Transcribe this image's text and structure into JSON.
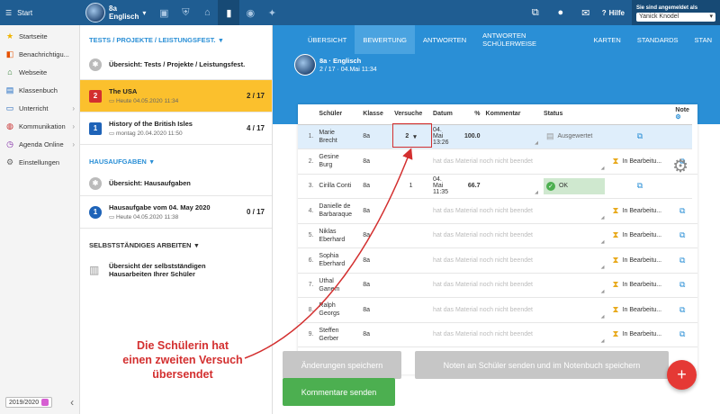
{
  "topbar": {
    "start_label": "Start",
    "class_name": "8a",
    "class_subject": "Englisch",
    "help_label": "Hilfe",
    "logged_in_label": "Sie sind angemeldet als",
    "user_name": "Yanick Knodel",
    "icons": [
      "briefcase-icon",
      "shield-icon",
      "school-icon",
      "chart-icon",
      "globe-icon",
      "walking-icon",
      "screen-share-icon",
      "chat-icon",
      "mail-icon",
      "help-icon"
    ]
  },
  "sidebar": {
    "items": [
      {
        "label": "Startseite",
        "icon": "star-icon"
      },
      {
        "label": "Benachrichtigu...",
        "icon": "bell-icon"
      },
      {
        "label": "Webseite",
        "icon": "house-icon"
      },
      {
        "label": "Klassenbuch",
        "icon": "book-icon"
      },
      {
        "label": "Unterricht",
        "icon": "folder-icon"
      },
      {
        "label": "Kommunikation",
        "icon": "chat-icon"
      },
      {
        "label": "Agenda Online",
        "icon": "clock-icon"
      },
      {
        "label": "Einstellungen",
        "icon": "gear-icon"
      }
    ],
    "year": "2019/2020"
  },
  "midpanel": {
    "section1": "TESTS / PROJEKTE / LEISTUNGSFEST.",
    "overview1": "Übersicht: Tests / Projekte / Leistungsfest.",
    "item1": {
      "badge": "2",
      "title": "The USA",
      "sub": "Heute 04.05.2020 11:34",
      "count": "2 / 17"
    },
    "item2": {
      "badge": "1",
      "title": "History of the British Isles",
      "sub": "montag 20.04.2020 11:50",
      "count": "4 / 17"
    },
    "section2": "HAUSAUFGABEN",
    "overview2": "Übersicht: Hausaufgaben",
    "item3": {
      "badge": "1",
      "title": "Hausaufgabe vom 04. May 2020",
      "sub": "Heute 04.05.2020 11:38",
      "count": "0 / 17"
    },
    "section3": "SELBSTSTÄNDIGES ARBEITEN",
    "item4": {
      "title1": "Übersicht der selbstständigen",
      "title2": "Hausarbeiten Ihrer Schüler"
    }
  },
  "main": {
    "tabs": [
      "ÜBERSICHT",
      "BEWERTUNG",
      "ANTWORTEN",
      "ANTWORTEN SCHÜLERWEISE",
      "KARTEN",
      "STANDARDS",
      "STAN"
    ],
    "active_tab": 1,
    "class_line": "8a · Englisch",
    "date_line": "2 / 17 · 04.Mai 11:34",
    "columns": [
      "",
      "Schüler",
      "Klasse",
      "Versuche",
      "Datum",
      "%",
      "Kommentar",
      "Status",
      "",
      "Note"
    ],
    "rows": [
      {
        "n": "1.",
        "name1": "Marie",
        "name2": "Brecht",
        "klasse": "8a",
        "tries": "2",
        "date": "04. Mai 13:26",
        "pct": "100.0",
        "status": "Ausgewertet",
        "kind": "evaluated"
      },
      {
        "n": "2.",
        "name1": "Gesine",
        "name2": "Burg",
        "klasse": "8a",
        "tries": "",
        "date": "hat das Material noch nicht beendet",
        "pct": "",
        "status": "In Bearbeitu...",
        "kind": "progress"
      },
      {
        "n": "3.",
        "name1": "Cirilla Conti",
        "name2": "",
        "klasse": "8a",
        "tries": "1",
        "date": "04. Mai 11:35",
        "pct": "66.7",
        "status": "OK",
        "kind": "ok"
      },
      {
        "n": "4.",
        "name1": "Danielle de",
        "name2": "Barbaraque",
        "klasse": "8a",
        "tries": "",
        "date": "hat das Material noch nicht beendet",
        "pct": "",
        "status": "In Bearbeitu...",
        "kind": "progress"
      },
      {
        "n": "5.",
        "name1": "Niklas",
        "name2": "Eberhard",
        "klasse": "8a",
        "tries": "",
        "date": "hat das Material noch nicht beendet",
        "pct": "",
        "status": "In Bearbeitu...",
        "kind": "progress"
      },
      {
        "n": "6.",
        "name1": "Sophia",
        "name2": "Eberhard",
        "klasse": "8a",
        "tries": "",
        "date": "hat das Material noch nicht beendet",
        "pct": "",
        "status": "In Bearbeitu...",
        "kind": "progress"
      },
      {
        "n": "7.",
        "name1": "Uthal",
        "name2": "Ganem",
        "klasse": "8a",
        "tries": "",
        "date": "hat das Material noch nicht beendet",
        "pct": "",
        "status": "In Bearbeitu...",
        "kind": "progress"
      },
      {
        "n": "8.",
        "name1": "Ralph",
        "name2": "Georgs",
        "klasse": "8a",
        "tries": "",
        "date": "hat das Material noch nicht beendet",
        "pct": "",
        "status": "In Bearbeitu...",
        "kind": "progress"
      },
      {
        "n": "9.",
        "name1": "Steffen",
        "name2": "Gerber",
        "klasse": "8a",
        "tries": "",
        "date": "hat das Material noch nicht beendet",
        "pct": "",
        "status": "In Bearbeitu...",
        "kind": "progress"
      }
    ]
  },
  "buttons": {
    "save_changes": "Änderungen speichern",
    "send_grades": "Noten an Schüler senden und im Notenbuch speichern",
    "send_comments": "Kommentare senden",
    "add": "+"
  },
  "annotation": {
    "line1": "Die Schülerin hat",
    "line2": "einen zweiten Versuch",
    "line3": "übersendet",
    "color": "#d32f2f"
  }
}
